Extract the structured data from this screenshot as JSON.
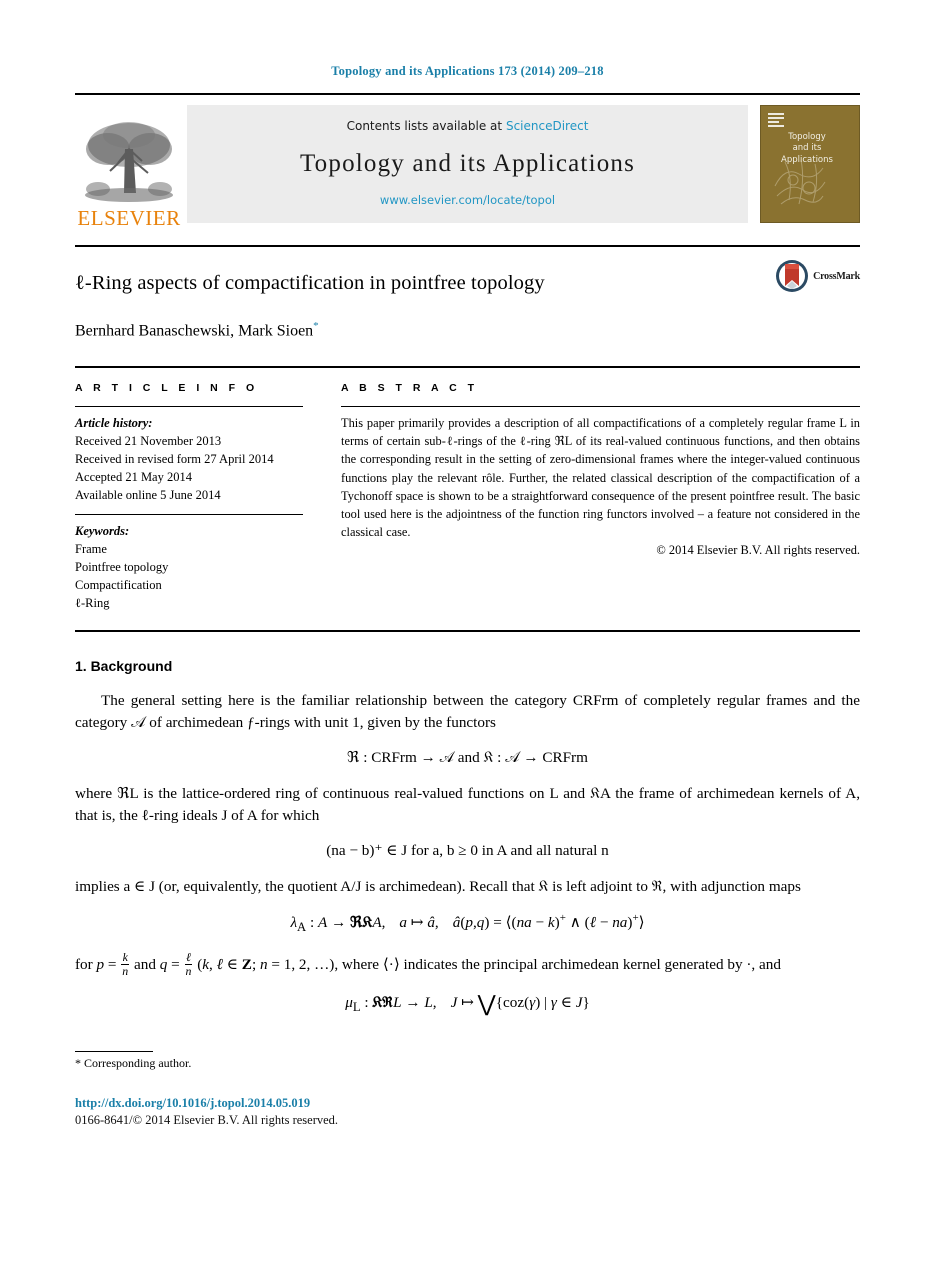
{
  "running_head": "Topology and its Applications 173 (2014) 209–218",
  "masthead": {
    "publisher_name": "ELSEVIER",
    "contents_prefix": "Contents lists available at",
    "sciencedirect": "ScienceDirect",
    "journal_title": "Topology and its Applications",
    "journal_url": "www.elsevier.com/locate/topol",
    "cover_title": "Topology\nand its\nApplications",
    "cover_color": "#8a7230",
    "link_color": "#2196c4",
    "elsevier_orange": "#e8820c"
  },
  "article": {
    "title": "ℓ-Ring aspects of compactification in pointfree topology",
    "authors": "Bernhard Banaschewski, Mark Sioen",
    "corresponding_marker": "*",
    "crossmark_label": "CrossMark"
  },
  "info": {
    "section_label": "A R T I C L E   I N F O",
    "history_heading": "Article history:",
    "history": [
      "Received 21 November 2013",
      "Received in revised form 27 April 2014",
      "Accepted 21 May 2014",
      "Available online 5 June 2014"
    ],
    "keywords_heading": "Keywords:",
    "keywords": [
      "Frame",
      "Pointfree topology",
      "Compactification",
      "ℓ-Ring"
    ]
  },
  "abstract": {
    "section_label": "A B S T R A C T",
    "text": "This paper primarily provides a description of all compactifications of a completely regular frame L in terms of certain sub-ℓ-rings of the ℓ-ring ℜL of its real-valued continuous functions, and then obtains the corresponding result in the setting of zero-dimensional frames where the integer-valued continuous functions play the relevant rôle. Further, the related classical description of the compactification of a Tychonoff space is shown to be a straightforward consequence of the present pointfree result. The basic tool used here is the adjointness of the function ring functors involved – a feature not considered in the classical case.",
    "copyright": "© 2014 Elsevier B.V. All rights reserved."
  },
  "body": {
    "section_heading": "1. Background",
    "para1": "The general setting here is the familiar relationship between the category CRFrm of completely regular frames and the category 𝒜 of archimedean ƒ-rings with unit 1, given by the functors",
    "eq1": "ℜ : CRFrm → 𝒜   and   𝔎 : 𝒜 → CRFrm",
    "para2": "where ℜL is the lattice-ordered ring of continuous real-valued functions on L and 𝔎A the frame of archimedean kernels of A, that is, the ℓ-ring ideals J of A for which",
    "eq2": "(na − b)⁺ ∈ J   for a, b ≥ 0 in A and all natural n",
    "para3": "implies a ∈ J (or, equivalently, the quotient A/J is archimedean). Recall that 𝔎 is left adjoint to ℜ, with adjunction maps",
    "eq3": "λ_A : A → ℜ𝔎A,   a ↦ â,   â(p, q) = ⟨(na − k)⁺ ∧ (ℓ − na)⁺⟩",
    "para4": "for p = k/n and q = ℓ/n (k, ℓ ∈ 𝐙; n = 1, 2, …), where ⟨·⟩ indicates the principal archimedean kernel generated by ·, and",
    "eq4": "μ_L : 𝔎ℜL → L,   J ↦ ⋁{coz(γ) | γ ∈ J}"
  },
  "footnote": {
    "marker": "*",
    "text": "Corresponding author."
  },
  "footer": {
    "doi": "http://dx.doi.org/10.1016/j.topol.2014.05.019",
    "issn_line": "0166-8641/© 2014 Elsevier B.V. All rights reserved.",
    "doi_color": "#1a7fa8"
  }
}
